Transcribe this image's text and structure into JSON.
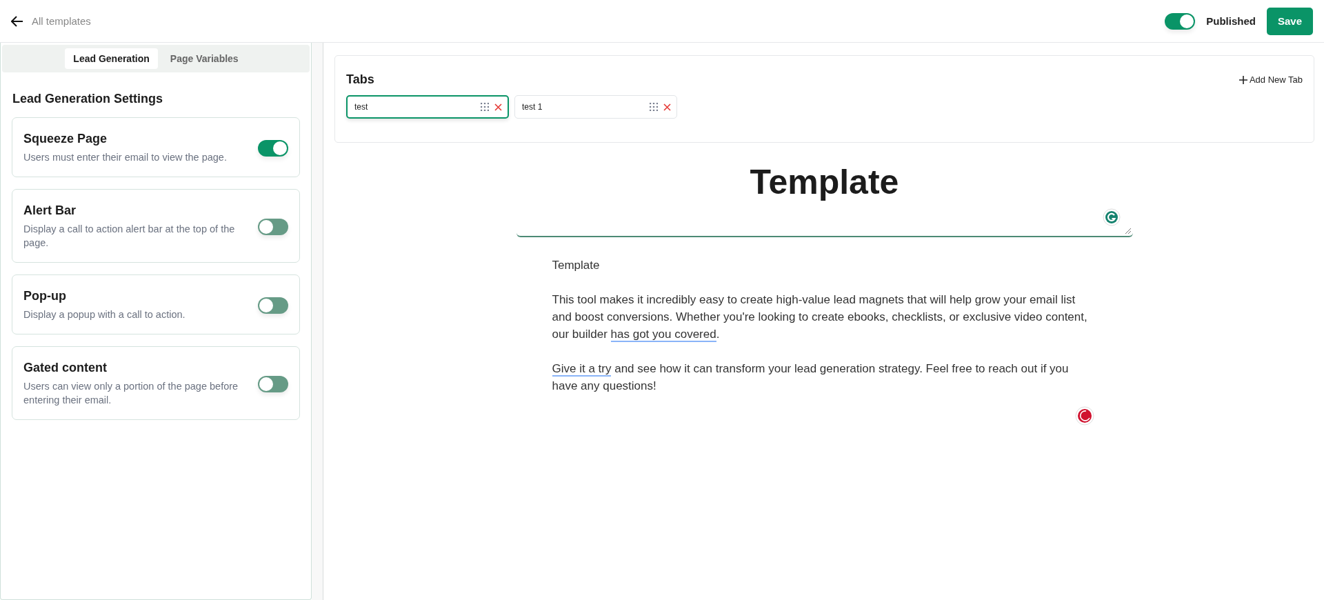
{
  "header": {
    "back_label": "All templates",
    "published": {
      "label": "Published",
      "on": true
    },
    "save_label": "Save"
  },
  "sidebar": {
    "tabs": [
      {
        "label": "Lead Generation",
        "selected": true
      },
      {
        "label": "Page Variables",
        "selected": false
      }
    ],
    "heading": "Lead Generation Settings",
    "settings": [
      {
        "title": "Squeeze Page",
        "description": "Users must enter their email to view the page.",
        "on": true
      },
      {
        "title": "Alert Bar",
        "description": "Display a call to action alert bar at the top of the page.",
        "on": false
      },
      {
        "title": "Pop-up",
        "description": "Display a popup with a call to action.",
        "on": false
      },
      {
        "title": "Gated content",
        "description": "Users can view only a portion of the page before entering their email.",
        "on": false
      }
    ]
  },
  "tabs_editor": {
    "title": "Tabs",
    "add_label": "Add New Tab",
    "tabs": [
      {
        "value": "test",
        "selected": true
      },
      {
        "value": "test 1",
        "selected": false
      }
    ]
  },
  "document": {
    "title": "Template",
    "paragraphs": [
      [
        {
          "text": "Template",
          "underlined": false
        }
      ],
      [
        {
          "text": "This tool makes it incredibly easy to create high-value lead magnets that will help grow your email list and boost conversions. Whether you're looking to create ebooks, checklists, or exclusive video content, our builder ",
          "underlined": false
        },
        {
          "text": "has got you covered",
          "underlined": true
        },
        {
          "text": ".",
          "underlined": false
        }
      ],
      [
        {
          "text": "Give it a try",
          "underlined": true
        },
        {
          "text": " and see how it can transform your lead generation strategy. Feel free to reach out if you have any questions!",
          "underlined": false
        }
      ]
    ]
  }
}
